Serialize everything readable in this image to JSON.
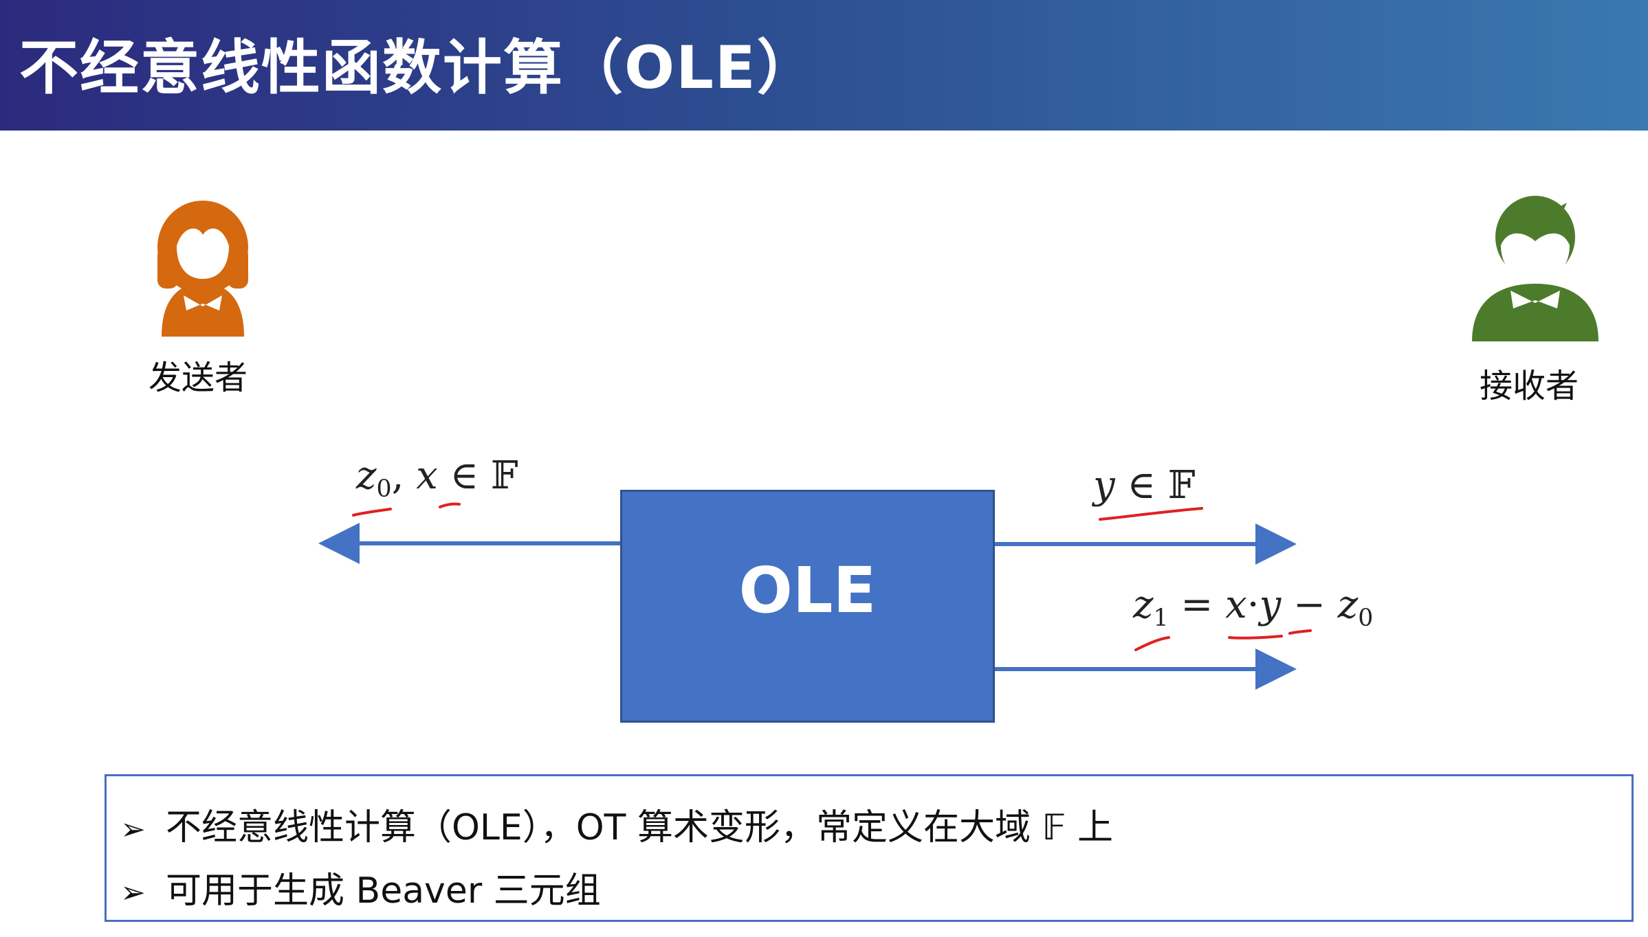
{
  "slide": {
    "title": "不经意线性函数计算（OLE）"
  },
  "sender": {
    "label": "发送者",
    "color": "#d4690f"
  },
  "receiver": {
    "label": "接收者",
    "color": "#4d7b2c"
  },
  "diagram": {
    "box_label": "OLE",
    "box_color": "#4472c4",
    "arrow_color": "#4472c4",
    "annotation_color": "#e02020",
    "sender_output": {
      "z": "z",
      "z_sub": "0",
      "sep": ",",
      "x": "x",
      "in": "∈",
      "field": "𝔽"
    },
    "receiver_input": {
      "y": "y",
      "in": "∈",
      "field": "𝔽"
    },
    "receiver_output": {
      "z": "z",
      "z_sub": "1",
      "eq": "=",
      "x": "x",
      "dot": "·",
      "y": "y",
      "minus": "−",
      "z0": "z",
      "z0_sub": "0"
    }
  },
  "notes": {
    "bullet_icon": "arrow-bullet-icon",
    "items": [
      {
        "text": "不经意线性计算（OLE），OT 算术变形，常定义在大域 𝔽 上"
      },
      {
        "text": "可用于生成 Beaver 三元组"
      }
    ]
  }
}
